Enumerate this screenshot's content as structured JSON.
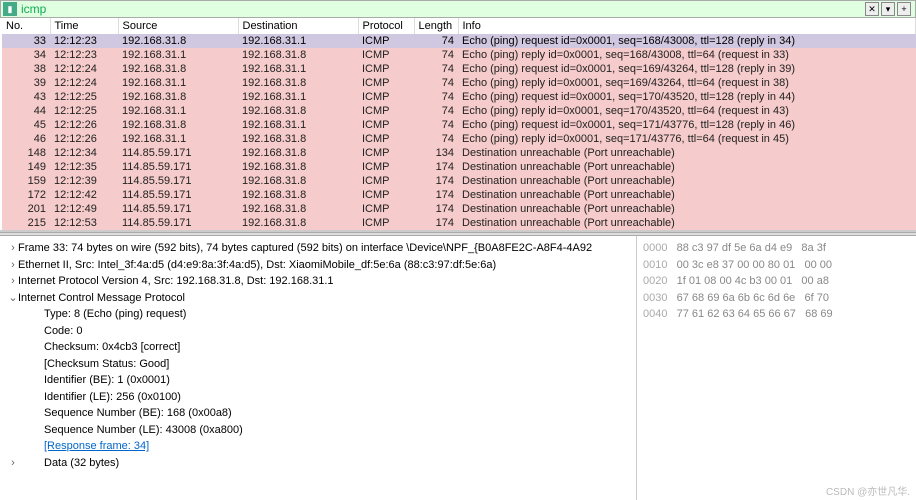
{
  "filter": {
    "value": "icmp",
    "icon": "bookmark-icon"
  },
  "filter_controls": {
    "clear": "✕",
    "dropdown": "▾",
    "add": "+"
  },
  "columns": [
    "No.",
    "Time",
    "Source",
    "Destination",
    "Protocol",
    "Length",
    "Info"
  ],
  "packets": [
    {
      "no": "33",
      "time": "12:12:23",
      "src": "192.168.31.8",
      "dst": "192.168.31.1",
      "proto": "ICMP",
      "len": "74",
      "info": "Echo (ping) request  id=0x0001, seq=168/43008, ttl=128 (reply in 34)",
      "cls": "sel"
    },
    {
      "no": "34",
      "time": "12:12:23",
      "src": "192.168.31.1",
      "dst": "192.168.31.8",
      "proto": "ICMP",
      "len": "74",
      "info": "Echo (ping) reply    id=0x0001, seq=168/43008, ttl=64 (request in 33)",
      "cls": "pink"
    },
    {
      "no": "38",
      "time": "12:12:24",
      "src": "192.168.31.8",
      "dst": "192.168.31.1",
      "proto": "ICMP",
      "len": "74",
      "info": "Echo (ping) request  id=0x0001, seq=169/43264, ttl=128 (reply in 39)",
      "cls": "pink"
    },
    {
      "no": "39",
      "time": "12:12:24",
      "src": "192.168.31.1",
      "dst": "192.168.31.8",
      "proto": "ICMP",
      "len": "74",
      "info": "Echo (ping) reply    id=0x0001, seq=169/43264, ttl=64 (request in 38)",
      "cls": "pink"
    },
    {
      "no": "43",
      "time": "12:12:25",
      "src": "192.168.31.8",
      "dst": "192.168.31.1",
      "proto": "ICMP",
      "len": "74",
      "info": "Echo (ping) request  id=0x0001, seq=170/43520, ttl=128 (reply in 44)",
      "cls": "pink"
    },
    {
      "no": "44",
      "time": "12:12:25",
      "src": "192.168.31.1",
      "dst": "192.168.31.8",
      "proto": "ICMP",
      "len": "74",
      "info": "Echo (ping) reply    id=0x0001, seq=170/43520, ttl=64 (request in 43)",
      "cls": "pink"
    },
    {
      "no": "45",
      "time": "12:12:26",
      "src": "192.168.31.8",
      "dst": "192.168.31.1",
      "proto": "ICMP",
      "len": "74",
      "info": "Echo (ping) request  id=0x0001, seq=171/43776, ttl=128 (reply in 46)",
      "cls": "pink"
    },
    {
      "no": "46",
      "time": "12:12:26",
      "src": "192.168.31.1",
      "dst": "192.168.31.8",
      "proto": "ICMP",
      "len": "74",
      "info": "Echo (ping) reply    id=0x0001, seq=171/43776, ttl=64 (request in 45)",
      "cls": "pink"
    },
    {
      "no": "148",
      "time": "12:12:34",
      "src": "114.85.59.171",
      "dst": "192.168.31.8",
      "proto": "ICMP",
      "len": "134",
      "info": "Destination unreachable (Port unreachable)",
      "cls": "pink"
    },
    {
      "no": "149",
      "time": "12:12:35",
      "src": "114.85.59.171",
      "dst": "192.168.31.8",
      "proto": "ICMP",
      "len": "174",
      "info": "Destination unreachable (Port unreachable)",
      "cls": "pink"
    },
    {
      "no": "159",
      "time": "12:12:39",
      "src": "114.85.59.171",
      "dst": "192.168.31.8",
      "proto": "ICMP",
      "len": "174",
      "info": "Destination unreachable (Port unreachable)",
      "cls": "pink"
    },
    {
      "no": "172",
      "time": "12:12:42",
      "src": "114.85.59.171",
      "dst": "192.168.31.8",
      "proto": "ICMP",
      "len": "174",
      "info": "Destination unreachable (Port unreachable)",
      "cls": "pink"
    },
    {
      "no": "201",
      "time": "12:12:49",
      "src": "114.85.59.171",
      "dst": "192.168.31.8",
      "proto": "ICMP",
      "len": "174",
      "info": "Destination unreachable (Port unreachable)",
      "cls": "pink"
    },
    {
      "no": "215",
      "time": "12:12:53",
      "src": "114.85.59.171",
      "dst": "192.168.31.8",
      "proto": "ICMP",
      "len": "174",
      "info": "Destination unreachable (Port unreachable)",
      "cls": "pink"
    }
  ],
  "tree": [
    {
      "t": ">",
      "d": 0,
      "txt": "Frame 33: 74 bytes on wire (592 bits), 74 bytes captured (592 bits) on interface \\Device\\NPF_{B0A8FE2C-A8F4-4A92"
    },
    {
      "t": ">",
      "d": 0,
      "txt": "Ethernet II, Src: Intel_3f:4a:d5 (d4:e9:8a:3f:4a:d5), Dst: XiaomiMobile_df:5e:6a (88:c3:97:df:5e:6a)"
    },
    {
      "t": ">",
      "d": 0,
      "txt": "Internet Protocol Version 4, Src: 192.168.31.8, Dst: 192.168.31.1"
    },
    {
      "t": "v",
      "d": 0,
      "txt": "Internet Control Message Protocol"
    },
    {
      "t": "",
      "d": 1,
      "txt": "Type: 8 (Echo (ping) request)"
    },
    {
      "t": "",
      "d": 1,
      "txt": "Code: 0"
    },
    {
      "t": "",
      "d": 1,
      "txt": "Checksum: 0x4cb3 [correct]"
    },
    {
      "t": "",
      "d": 1,
      "txt": "[Checksum Status: Good]"
    },
    {
      "t": "",
      "d": 1,
      "txt": "Identifier (BE): 1 (0x0001)"
    },
    {
      "t": "",
      "d": 1,
      "txt": "Identifier (LE): 256 (0x0100)"
    },
    {
      "t": "",
      "d": 1,
      "txt": "Sequence Number (BE): 168 (0x00a8)"
    },
    {
      "t": "",
      "d": 1,
      "txt": "Sequence Number (LE): 43008 (0xa800)"
    },
    {
      "t": "",
      "d": 1,
      "txt": "[Response frame: 34]",
      "link": true
    },
    {
      "t": ">",
      "d": 1,
      "txt": "Data (32 bytes)"
    }
  ],
  "hex": [
    {
      "off": "0000",
      "b": "88 c3 97 df 5e 6a d4 e9   8a 3f"
    },
    {
      "off": "0010",
      "b": "00 3c e8 37 00 00 80 01   00 00"
    },
    {
      "off": "0020",
      "b": "1f 01 08 00 4c b3 00 01   00 a8"
    },
    {
      "off": "0030",
      "b": "67 68 69 6a 6b 6c 6d 6e   6f 70"
    },
    {
      "off": "0040",
      "b": "77 61 62 63 64 65 66 67   68 69"
    }
  ],
  "watermark": "CSDN @亦世凡华."
}
